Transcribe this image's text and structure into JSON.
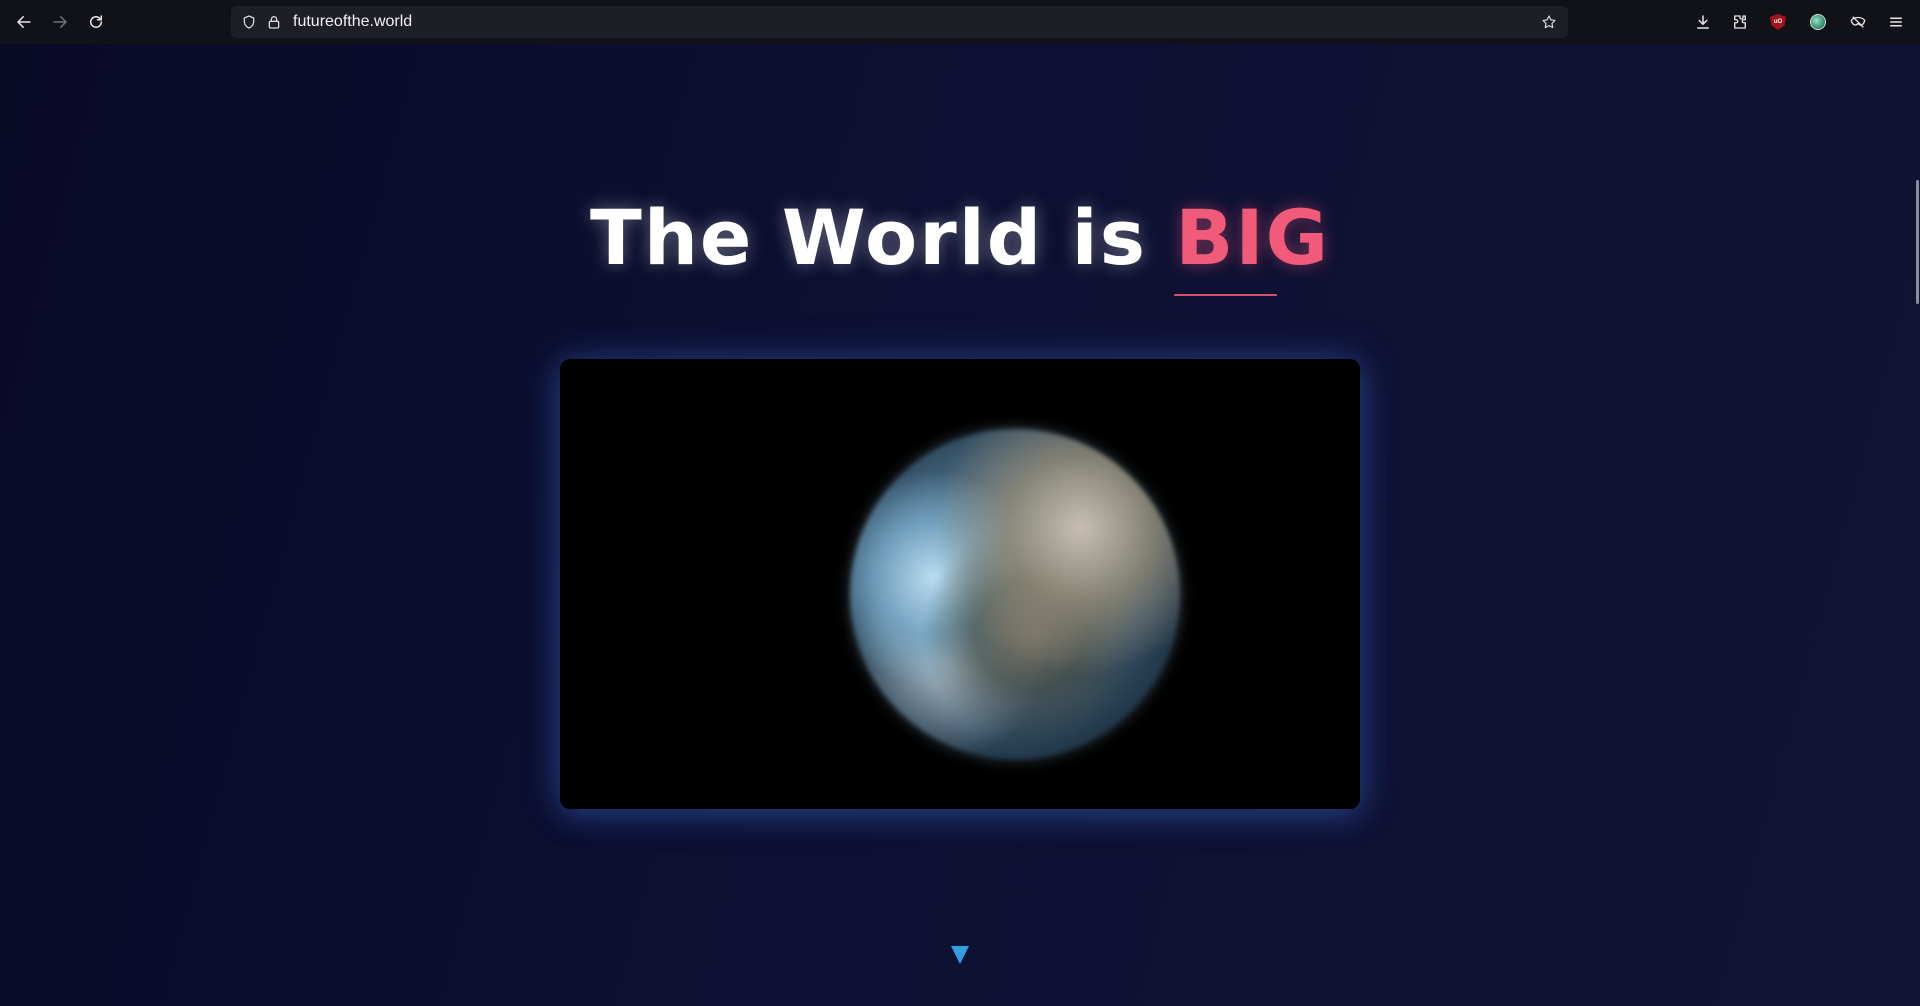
{
  "browser": {
    "url": "futureofthe.world",
    "back_icon": "arrow-left-icon",
    "forward_icon": "arrow-right-icon",
    "reload_icon": "reload-icon",
    "tracking_icon": "shield-icon",
    "lock_icon": "lock-icon",
    "bookmark_icon": "star-icon",
    "downloads_icon": "download-icon",
    "extensions_icon": "puzzle-icon",
    "ublock_label": "uO",
    "menu_icon": "hamburger-menu-icon"
  },
  "hero": {
    "headline_prefix": "The World is ",
    "headline_accent": "BIG",
    "accent_color": "#f25a7a",
    "scroll_arrow_color": "#2f9fe0"
  },
  "media": {
    "type": "video",
    "subject": "rotating-earth-globe"
  }
}
